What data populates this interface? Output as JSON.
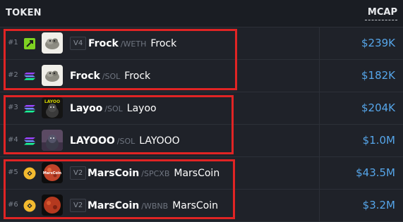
{
  "header": {
    "token_label": "TOKEN",
    "mcap_label": "MCAP"
  },
  "rows": [
    {
      "rank": "#1",
      "chain": "lime-chain-icon",
      "version": "V4",
      "symbol": "Frock",
      "pair": "/WETH",
      "name": "Frock",
      "mcap": "$239K"
    },
    {
      "rank": "#2",
      "chain": "solana-icon",
      "version": "",
      "symbol": "Frock",
      "pair": "/SOL",
      "name": "Frock",
      "mcap": "$182K"
    },
    {
      "rank": "#3",
      "chain": "solana-icon",
      "version": "",
      "symbol": "Layoo",
      "pair": "/SOL",
      "name": "Layoo",
      "mcap": "$204K"
    },
    {
      "rank": "#4",
      "chain": "solana-icon",
      "version": "",
      "symbol": "LAYOOO",
      "pair": "/SOL",
      "name": "LAYOOO",
      "mcap": "$1.0M"
    },
    {
      "rank": "#5",
      "chain": "bnb-icon",
      "version": "V2",
      "symbol": "MarsCoin",
      "pair": "/SPCXB",
      "name": "MarsCoin",
      "mcap": "$43.5M"
    },
    {
      "rank": "#6",
      "chain": "bnb-icon",
      "version": "V2",
      "symbol": "MarsCoin",
      "pair": "/WBNB",
      "name": "MarsCoin",
      "mcap": "$3.2M"
    }
  ],
  "logo_texts": {
    "row3": "LAYOO",
    "row5": "MarsCoin"
  },
  "colors": {
    "highlight": "#e02424",
    "mcap": "#56a6ea",
    "background": "#1f2229"
  }
}
